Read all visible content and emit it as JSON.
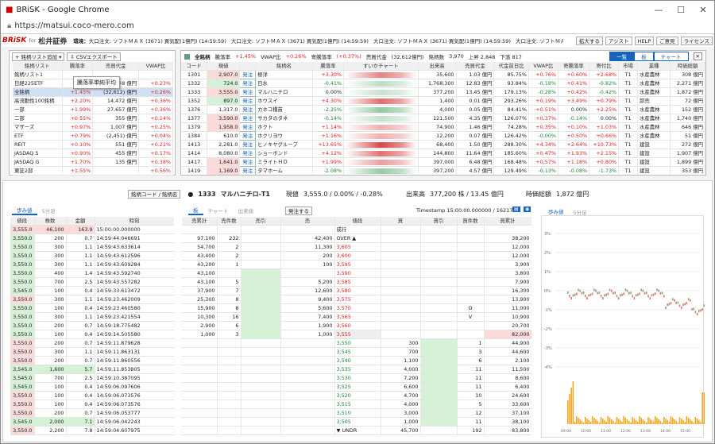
{
  "window": {
    "title": "BRiSK - Google Chrome",
    "url": "https://matsui.coco-mero.com"
  },
  "header": {
    "logo": "BRiSK",
    "for": "for",
    "firm": "松井証券",
    "env": "環境：",
    "ticker": "大口注文: ソフトＭＡＸ (3671)  買気配(1億円)  (14:59:59)",
    "ticker2": "大口注文: ソフトＭＡＸ (3671)  買気配(1億円)  (14:59:59)",
    "ticker3": "大口注文: ソフトＭＡＸ (3671)  買気配(1億円)  (14:59:59)",
    "ticker4": "大口注文: ソフトＭＡＸ (3671)  買気配(1億円)  (14:",
    "buttons": [
      "拡大する",
      "アシスト",
      "HELP",
      "ご意見",
      "ライセンス"
    ]
  },
  "left_list": {
    "add_btn": "銘柄リスト追加",
    "csv_btn": "CSVエクスポート",
    "tooltip": "騰落率単純平均",
    "cols": [
      "銘柄リスト",
      "騰落率",
      "売買代金",
      "VWAP比"
    ],
    "rows": [
      [
        "銘柄リスト1",
        "",
        "",
        ""
      ],
      [
        "日経225ETF",
        "",
        "248 億円",
        "+0.23%"
      ],
      [
        "全銘柄",
        "+1.45%",
        "(32,612) 億円",
        "+0.26%"
      ],
      [
        "高流動性100銘柄",
        "+2.20%",
        "14,472 億円",
        "+0.36%"
      ],
      [
        "一部",
        "+1.99%",
        "27,657 億円",
        "+0.36%"
      ],
      [
        "二部",
        "+0.55%",
        "355 億円",
        "+0.14%"
      ],
      [
        "マザーズ",
        "+0.97%",
        "1,007 億円",
        "+0.25%"
      ],
      [
        "ETF",
        "+0.79%",
        "(2,451) 億円",
        "+0.04%"
      ],
      [
        "REIT",
        "+0.10%",
        "551 億円",
        "+0.21%"
      ],
      [
        "JASDAQ S",
        "+0.90%",
        "455 億円",
        "+0.17%"
      ],
      [
        "JASDAQ G",
        "+1.70%",
        "135 億円",
        "+0.38%"
      ],
      [
        "東証2部",
        "+1.55%",
        "",
        "+0.56%"
      ]
    ]
  },
  "stock_list": {
    "title": "全銘柄",
    "up_label": "騰落率",
    "up_val": "+1.45%",
    "vwap_label": "VWAP比",
    "vwap_val": "+0.26%",
    "ytd_label": "寄騰落率",
    "ytd_val": "(+0.37%)",
    "amt_label": "売買代金",
    "amt_val": "(32,612億円)",
    "count_label": "銘柄数",
    "count_val": "3,970",
    "up_cnt": "上昇 2,848",
    "dn_cnt": "下落 817",
    "views": [
      "一覧",
      "板",
      "チャート"
    ],
    "cols": [
      "コード",
      "現値",
      "",
      "銘柄名",
      "騰落率",
      "すいかチャート",
      "出来高",
      "売買代金",
      "代金前日比",
      "VWAP比",
      "寄騰落率",
      "寄付比",
      "市場",
      "業種",
      "時価総額"
    ],
    "rows": [
      [
        "1301",
        "2,907.0",
        "発注",
        "極洋",
        "+3.30%",
        "35,600",
        "1.03 億円",
        "85.75%",
        "+0.76%",
        "+0.60%",
        "+2.68%",
        "T1",
        "水産農林",
        "308 億円"
      ],
      [
        "1332",
        "724.0",
        "発注",
        "日水",
        "-0.41%",
        "1,768,300",
        "12.83 億円",
        "93.84%",
        "-0.18%",
        "+0.41%",
        "-0.82%",
        "T1",
        "水産農林",
        "2,271 億円"
      ],
      [
        "1333",
        "3,555.0",
        "発注",
        "マルハニチロ",
        "0.00%",
        "377,200",
        "13.45 億円",
        "179.13%",
        "-0.28%",
        "+0.42%",
        "-0.42%",
        "T1",
        "水産農林",
        "1,872 億円"
      ],
      [
        "1352",
        "897.0",
        "発注",
        "ホウスイ",
        "+4.30%",
        "1,400",
        "0.01 億円",
        "293.26%",
        "+0.19%",
        "+3.49%",
        "+0.79%",
        "T1",
        "卸売",
        "72 億円"
      ],
      [
        "1376",
        "1,317.0",
        "発注",
        "カネコ種苗",
        "-2.25%",
        "4,000",
        "0.05 億円",
        "84.41%",
        "+0.51%",
        "0.00%",
        "+2.25%",
        "T1",
        "水産農林",
        "152 億円"
      ],
      [
        "1377",
        "3,590.0",
        "発注",
        "サカタのタネ",
        "-0.14%",
        "121,500",
        "4.35 億円",
        "126.07%",
        "+0.37%",
        "-0.14%",
        "0.00%",
        "T1",
        "水産農林",
        "1,740 億円"
      ],
      [
        "1379",
        "1,958.0",
        "発注",
        "ホクト",
        "+1.14%",
        "74,900",
        "1.46 億円",
        "74.28%",
        "+0.35%",
        "+0.10%",
        "+1.03%",
        "T1",
        "水産農林",
        "646 億円"
      ],
      [
        "1384",
        "610.0",
        "発注",
        "ホクリヨウ",
        "+1.16%",
        "12,200",
        "0.07 億円",
        "126.42%",
        "-0.00%",
        "+0.50%",
        "+0.66%",
        "T1",
        "水産農林",
        "51 億円"
      ],
      [
        "1413",
        "2,281.0",
        "発注",
        "ヒノキヤグループ",
        "+13.65%",
        "68,400",
        "1.50 億円",
        "288.30%",
        "+4.34%",
        "+2.64%",
        "+10.73%",
        "T1",
        "建設",
        "272 億円"
      ],
      [
        "1414",
        "8,080.0",
        "発注",
        "ショーボンド",
        "+4.12%",
        "144,800",
        "11.64 億円",
        "185.60%",
        "+0.47%",
        "+1.93%",
        "+2.15%",
        "T1",
        "建設",
        "1,907 億円"
      ],
      [
        "1417",
        "1,641.0",
        "発注",
        "ミライトＨＤ",
        "+1.99%",
        "397,000",
        "6.48 億円",
        "168.48%",
        "+0.57%",
        "+1.18%",
        "+0.80%",
        "T1",
        "建設",
        "1,899 億円"
      ],
      [
        "1419",
        "1,169.0",
        "発注",
        "タマホーム",
        "-2.08%",
        "397,200",
        "4.57 億円",
        "129.49%",
        "-0.13%",
        "-0.08%",
        "-1.73%",
        "T1",
        "建設",
        "353 億円"
      ]
    ]
  },
  "detail": {
    "code_btn": "銘柄コード / 銘柄名",
    "code": "1333",
    "name": "マルハニチロ-T1",
    "price_label": "現値",
    "price": "3,555.0 / 0.00% / -0.28%",
    "vol_label": "出来高",
    "vol": "377,200 株 / 13.45 億円",
    "mcap_label": "時価総額",
    "mcap": "1,872 億円",
    "timestamp": "Timestamp  15:00:00.000000 / 16217"
  },
  "ticks": {
    "tabs": [
      "歩み値",
      "5分足"
    ],
    "cols": [
      "値段",
      "株数",
      "金額",
      "時刻"
    ],
    "rows": [
      [
        "3,555.0",
        "46,100",
        "163.9",
        "15:00:00.000000",
        "p"
      ],
      [
        "3,550.0",
        "200",
        "0.7",
        "14:59:44.046691",
        "g"
      ],
      [
        "3,550.0",
        "300",
        "1.1",
        "14:59:43.633614",
        "g"
      ],
      [
        "3,550.0",
        "300",
        "1.1",
        "14:59:43.612596",
        "g"
      ],
      [
        "3,550.0",
        "300",
        "1.1",
        "14:59:43.609284",
        "g"
      ],
      [
        "3,550.0",
        "400",
        "1.4",
        "14:59:43.592740",
        "g"
      ],
      [
        "3,550.0",
        "700",
        "2.5",
        "14:59:43.557282",
        "g"
      ],
      [
        "3,545.0",
        "100",
        "0.4",
        "14:59:33.613472",
        "g"
      ],
      [
        "3,550.0",
        "300",
        "1.1",
        "14:59:23.462009",
        "p"
      ],
      [
        "3,550.0",
        "100",
        "0.4",
        "14:59:23.460580",
        "g"
      ],
      [
        "3,550.0",
        "300",
        "1.1",
        "14:59:23.421554",
        "g"
      ],
      [
        "3,550.0",
        "200",
        "0.7",
        "14:59:18.775482",
        "g"
      ],
      [
        "3,550.0",
        "100",
        "0.4",
        "14:59:14.505580",
        "g"
      ],
      [
        "3,550.0",
        "200",
        "0.7",
        "14:59:11.879628",
        "p"
      ],
      [
        "3,550.0",
        "300",
        "1.1",
        "14:59:11.863131",
        "p"
      ],
      [
        "3,550.0",
        "200",
        "0.7",
        "14:59:11.860556",
        "p"
      ],
      [
        "3,545.0",
        "1,600",
        "5.7",
        "14:59:11.853805",
        "g"
      ],
      [
        "3,545.0",
        "700",
        "2.5",
        "14:59:10.387095",
        "g"
      ],
      [
        "3,545.0",
        "100",
        "0.4",
        "14:59:06.097606",
        "g"
      ],
      [
        "3,550.0",
        "100",
        "0.4",
        "14:59:06.073576",
        "p"
      ],
      [
        "3,550.0",
        "100",
        "0.4",
        "14:59:06.073576",
        "p"
      ],
      [
        "3,550.0",
        "200",
        "0.7",
        "14:59:06.053777",
        "p"
      ],
      [
        "3,545.0",
        "2,000",
        "7.1",
        "14:59:06.042243",
        "g"
      ],
      [
        "3,550.0",
        "2,200",
        "7.8",
        "14:59:04.607975",
        "p"
      ]
    ]
  },
  "board": {
    "tabs": [
      "板",
      "チャート",
      "出来値"
    ],
    "order_btn": "発注する",
    "cols": [
      "売累計",
      "売件数",
      "売引",
      "売",
      "値段",
      "買",
      "買引",
      "買件数",
      "買累計"
    ],
    "rows": [
      [
        "",
        "",
        "",
        "",
        "成行",
        "",
        "",
        "",
        ""
      ],
      [
        "97,100",
        "232",
        "",
        "42,400",
        "OVER ▲",
        "",
        "",
        "",
        "38,200"
      ],
      [
        "54,700",
        "2",
        "",
        "11,300",
        "3,605",
        "",
        "",
        "",
        "12,000"
      ],
      [
        "43,400",
        "2",
        "",
        "200",
        "3,600",
        "",
        "",
        "",
        "12,000"
      ],
      [
        "43,200",
        "1",
        "",
        "100",
        "3,595",
        "",
        "",
        "",
        "3,900"
      ],
      [
        "43,100",
        "",
        "",
        "",
        "3,590",
        "",
        "",
        "",
        "3,800"
      ],
      [
        "43,100",
        "5",
        "",
        "5,200",
        "3,585",
        "",
        "",
        "",
        "7,900"
      ],
      [
        "37,900",
        "7",
        "",
        "12,600",
        "3,580",
        "",
        "",
        "",
        "16,300"
      ],
      [
        "25,300",
        "8",
        "",
        "9,400",
        "3,575",
        "",
        "",
        "",
        "13,900"
      ],
      [
        "15,900",
        "8",
        "",
        "5,600",
        "3,570",
        "",
        "",
        "O",
        "11,000"
      ],
      [
        "10,300",
        "16",
        "",
        "7,400",
        "3,565",
        "",
        "",
        "V",
        "10,900"
      ],
      [
        "2,900",
        "6",
        "",
        "1,900",
        "3,560",
        "",
        "",
        "",
        "20,700"
      ],
      [
        "1,000",
        "3",
        "",
        "1,000",
        "3,555",
        "",
        "",
        "",
        "82,000"
      ],
      [
        "",
        "",
        "",
        "",
        "3,550",
        "300",
        "",
        "1",
        "44,900"
      ],
      [
        "",
        "",
        "",
        "",
        "3,545",
        "700",
        "",
        "3",
        "44,600"
      ],
      [
        "",
        "",
        "",
        "",
        "3,540",
        "1,100",
        "",
        "6",
        "2,100"
      ],
      [
        "",
        "",
        "",
        "",
        "3,535",
        "4,000",
        "",
        "11",
        "11,500"
      ],
      [
        "",
        "",
        "",
        "",
        "3,530",
        "7,200",
        "",
        "11",
        "8,600"
      ],
      [
        "",
        "",
        "",
        "",
        "3,525",
        "6,600",
        "",
        "11",
        "6,400"
      ],
      [
        "",
        "",
        "",
        "",
        "3,520",
        "4,700",
        "",
        "10",
        "24,600"
      ],
      [
        "",
        "",
        "",
        "",
        "3,515",
        "4,000",
        "",
        "5",
        "33,600"
      ],
      [
        "",
        "",
        "",
        "",
        "3,510",
        "3,000",
        "",
        "12",
        "37,100"
      ],
      [
        "",
        "",
        "",
        "",
        "3,505",
        "1,000",
        "",
        "11",
        "38,100"
      ],
      [
        "",
        "",
        "",
        "",
        "▼ UNDR",
        "45,700",
        "",
        "192",
        "83,800"
      ]
    ]
  },
  "chart": {
    "tabs": [
      "歩み値",
      "5分足"
    ],
    "yticks": [
      "3%",
      "2%",
      "1%",
      "0%",
      "-1%",
      "-2%",
      "-3%",
      "-4%"
    ],
    "xticks": [
      "09:00",
      "10:00",
      "11:00",
      "12:00",
      "13:00",
      "14:00",
      "15:00"
    ]
  }
}
